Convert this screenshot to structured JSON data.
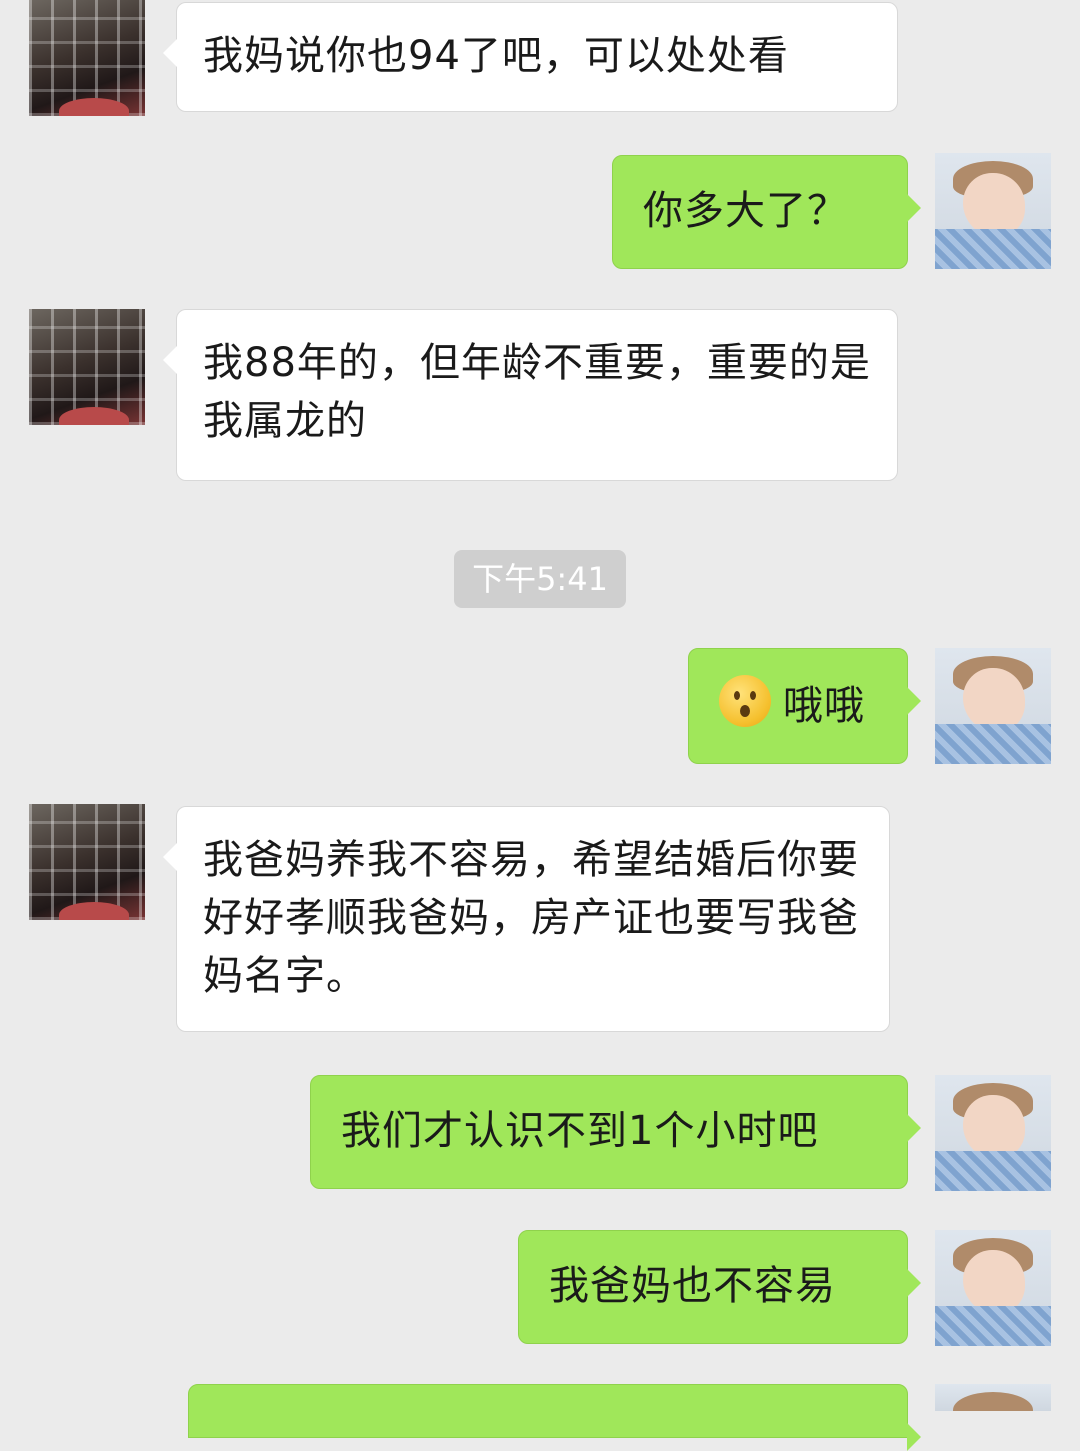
{
  "messages": [
    {
      "side": "left",
      "text": "我妈说你也94了吧，可以处处看"
    },
    {
      "side": "right",
      "text": "你多大了？"
    },
    {
      "side": "left",
      "text": "我88年的，但年龄不重要，重要的是我属龙的"
    },
    {
      "side": "right",
      "text": "哦哦",
      "emoji": "hushed-face-emoji"
    },
    {
      "side": "left",
      "text": "我爸妈养我不容易，希望结婚后你要好好孝顺我爸妈，房产证也要写我爸妈名字。"
    },
    {
      "side": "right",
      "text": "我们才认识不到1个小时吧"
    },
    {
      "side": "right",
      "text": "我爸妈也不容易"
    },
    {
      "side": "right",
      "text": ""
    }
  ],
  "timestamp": "下午5:41",
  "colors": {
    "background": "#ebebeb",
    "incoming_bubble": "#ffffff",
    "outgoing_bubble": "#a0e75a",
    "timestamp_bg": "#cfcfcf"
  }
}
